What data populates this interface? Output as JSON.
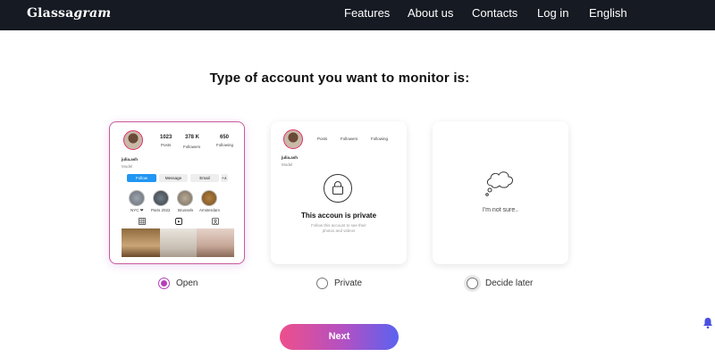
{
  "header": {
    "logo_main": "Glassa",
    "logo_ital": "gram",
    "nav": [
      "Features",
      "About us",
      "Contacts",
      "Log in",
      "English"
    ]
  },
  "page": {
    "title": "Type of account you want to monitor is:"
  },
  "open_card": {
    "stats": [
      {
        "num": "1023",
        "label": "Posts"
      },
      {
        "num": "378 K",
        "label": "Followers"
      },
      {
        "num": "650",
        "label": "Following"
      }
    ],
    "username": "julia.ash",
    "bio": "Model",
    "buttons": [
      "Follow",
      "Message",
      "Email",
      "+∧"
    ],
    "stories": [
      "NYC ❤",
      "Paris 2022",
      "Brussels",
      "Amsterdam"
    ]
  },
  "private_card": {
    "stat_labels": [
      "Posts",
      "Followers",
      "Following"
    ],
    "username": "julia.ash",
    "bio": "Model",
    "title": "This accoun is private",
    "subtitle": "Follow this account to see their photos and videos"
  },
  "unsure_card": {
    "text": "I'm not sure.."
  },
  "options": [
    {
      "label": "Open",
      "selected": true
    },
    {
      "label": "Private",
      "selected": false
    },
    {
      "label": "Decide later",
      "selected": false
    }
  ],
  "next_label": "Next",
  "colors": {
    "accent": "#b23fb8",
    "header_bg": "#161a22",
    "follow_blue": "#2196f3",
    "bell": "#4a4fe0"
  }
}
